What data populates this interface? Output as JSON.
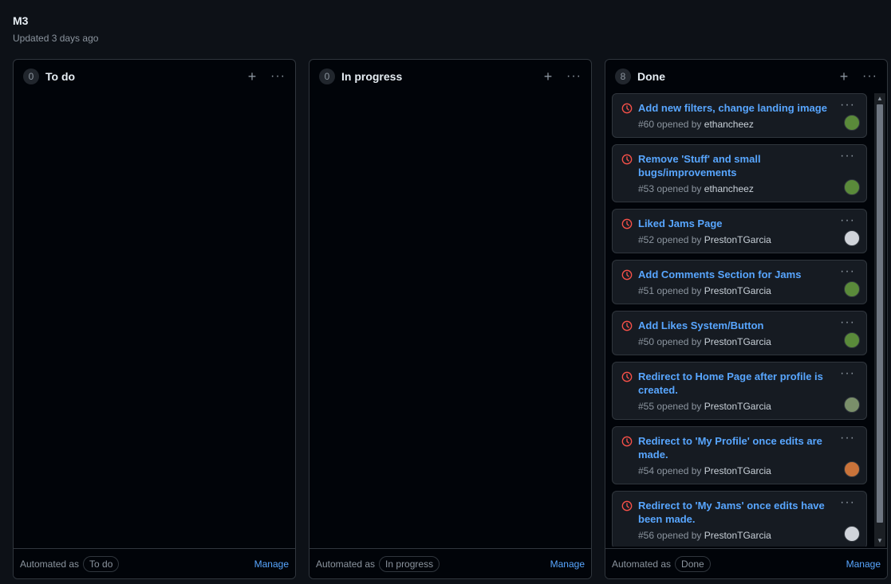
{
  "board": {
    "title": "M3",
    "updated": "Updated 3 days ago"
  },
  "columns": [
    {
      "count": "0",
      "name": "To do",
      "add_icon": "plus-icon",
      "menu_icon": "kebab-horizontal-icon",
      "footer": {
        "automated_label": "Automated as",
        "automated_value": "To do",
        "manage": "Manage"
      }
    },
    {
      "count": "0",
      "name": "In progress",
      "add_icon": "plus-icon",
      "menu_icon": "kebab-horizontal-icon",
      "footer": {
        "automated_label": "Automated as",
        "automated_value": "In progress",
        "manage": "Manage"
      }
    },
    {
      "count": "8",
      "name": "Done",
      "add_icon": "plus-icon",
      "menu_icon": "kebab-horizontal-icon",
      "footer": {
        "automated_label": "Automated as",
        "automated_value": "Done",
        "manage": "Manage"
      },
      "cards": [
        {
          "title": "Add new filters, change landing image",
          "number": "#60",
          "opened_by": "opened by",
          "author": "ethancheez",
          "avatar_color": "#5a8a3a"
        },
        {
          "title": "Remove 'Stuff' and small bugs/improvements",
          "number": "#53",
          "opened_by": "opened by",
          "author": "ethancheez",
          "avatar_color": "#5a8a3a"
        },
        {
          "title": "Liked Jams Page",
          "number": "#52",
          "opened_by": "opened by",
          "author": "PrestonTGarcia",
          "avatar_color": "#d0d4da"
        },
        {
          "title": "Add Comments Section for Jams",
          "number": "#51",
          "opened_by": "opened by",
          "author": "PrestonTGarcia",
          "avatar_color": "#5a8a3a"
        },
        {
          "title": "Add Likes System/Button",
          "number": "#50",
          "opened_by": "opened by",
          "author": "PrestonTGarcia",
          "avatar_color": "#5a8a3a"
        },
        {
          "title": "Redirect to Home Page after profile is created.",
          "number": "#55",
          "opened_by": "opened by",
          "author": "PrestonTGarcia",
          "avatar_color": "#7a8f6a"
        },
        {
          "title": "Redirect to 'My Profile' once edits are made.",
          "number": "#54",
          "opened_by": "opened by",
          "author": "PrestonTGarcia",
          "avatar_color": "#c9733a"
        },
        {
          "title": "Redirect to 'My Jams' once edits have been made.",
          "number": "#56",
          "opened_by": "opened by",
          "author": "PrestonTGarcia",
          "avatar_color": "#d0d4da"
        }
      ]
    }
  ],
  "colors": {
    "background": "#0d1117",
    "link": "#58a6ff",
    "closed_pr_icon": "#f85149"
  }
}
